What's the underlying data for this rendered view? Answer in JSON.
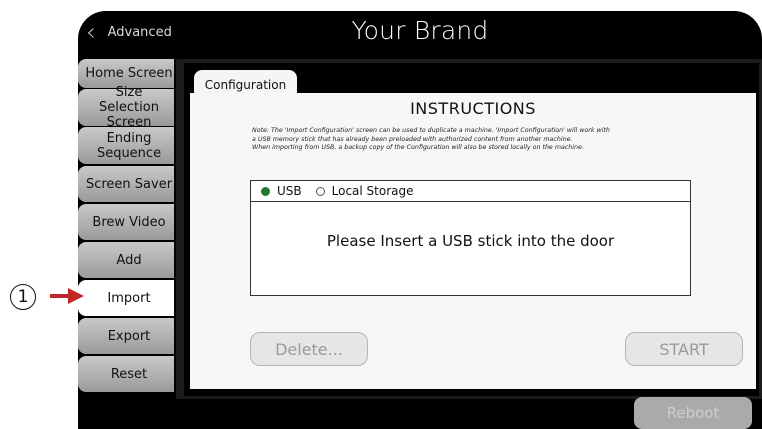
{
  "header": {
    "back_label": "Advanced",
    "brand": "Your Brand"
  },
  "sidebar": {
    "items": [
      {
        "label": "Home Screen"
      },
      {
        "label": "Size Selection Screen"
      },
      {
        "label": "Ending Sequence"
      },
      {
        "label": "Screen Saver"
      },
      {
        "label": "Brew Video"
      },
      {
        "label": "Add"
      },
      {
        "label": "Import",
        "active": true
      },
      {
        "label": "Export"
      },
      {
        "label": "Reset"
      }
    ]
  },
  "config": {
    "tab_label": "Configuration",
    "title": "INSTRUCTIONS",
    "note_lines": [
      "Note: The 'Import Configuration' screen can be used to duplicate a machine. 'Import Configuration' will work with",
      "a USB memory stick that has already been preloaded with authorized content from another machine.",
      "When importing from USB, a backup copy of the Configuration will also be stored locally on the machine."
    ],
    "source_options": [
      {
        "label": "USB",
        "selected": true
      },
      {
        "label": "Local Storage",
        "selected": false
      }
    ],
    "usb_message": "Please Insert a USB stick into the door",
    "delete_label": "Delete...",
    "start_label": "START"
  },
  "footer": {
    "reboot_label": "Reboot"
  },
  "annotation": {
    "number": "1"
  },
  "colors": {
    "selected_radio": "#1f7a2e",
    "arrow": "#c0282a",
    "active_tab": "#ffffff"
  },
  "icons": {
    "back": "chevron-left-icon",
    "arrow": "arrow-right-icon"
  }
}
